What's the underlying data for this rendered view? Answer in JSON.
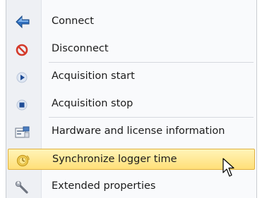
{
  "menu": {
    "items": [
      {
        "label": "Connect",
        "icon": "connect-arrow-icon"
      },
      {
        "label": "Disconnect",
        "icon": "disconnect-icon"
      },
      {
        "label": "Acquisition start",
        "icon": "play-icon"
      },
      {
        "label": "Acquisition stop",
        "icon": "stop-icon"
      },
      {
        "label": "Hardware and license information",
        "icon": "hardware-info-icon"
      },
      {
        "label": "Synchronize logger time",
        "icon": "sync-time-icon",
        "highlighted": true
      },
      {
        "label": "Extended properties",
        "icon": "wrench-icon"
      }
    ],
    "highlight_color": "#ffe48a"
  }
}
